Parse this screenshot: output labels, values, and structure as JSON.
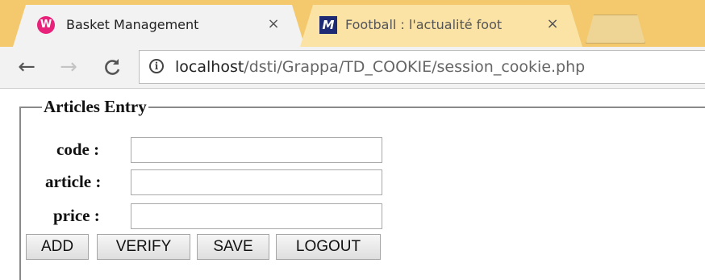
{
  "browser": {
    "tabs": [
      {
        "title": "Basket Management",
        "favicon": "wamp-icon",
        "active": true
      },
      {
        "title": "Football : l'actualité foot",
        "favicon": "m-logo-icon",
        "active": false
      }
    ],
    "address": {
      "host": "localhost",
      "path": "/dsti/Grappa/TD_COOKIE/session_cookie.php"
    },
    "icons": {
      "back": "←",
      "forward": "→",
      "reload": "C",
      "close": "×",
      "info": "i"
    }
  },
  "form": {
    "legend": "Articles Entry",
    "fields": [
      {
        "label": "code :",
        "value": ""
      },
      {
        "label": "article :",
        "value": ""
      },
      {
        "label": "price :",
        "value": ""
      }
    ],
    "buttons": {
      "add": "ADD",
      "verify": "VERIFY",
      "save": "SAVE",
      "logout": "LOGOUT"
    }
  },
  "colors": {
    "tabstrip": "#f4c96e",
    "wamp_favicon": "#e8227b",
    "m_favicon": "#1e2a73"
  }
}
